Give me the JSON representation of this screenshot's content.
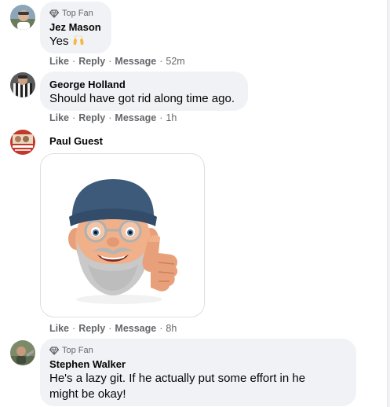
{
  "comments": [
    {
      "badge": "Top Fan",
      "author": "Jez Mason",
      "text": "Yes",
      "emoji": "raised-hands-emoji",
      "actions": {
        "like": "Like",
        "reply": "Reply",
        "message": "Message",
        "time": "52m"
      }
    },
    {
      "author": "George Holland",
      "text": "Should have got rid along time ago.",
      "actions": {
        "like": "Like",
        "reply": "Reply",
        "message": "Message",
        "time": "1h"
      }
    },
    {
      "author": "Paul Guest",
      "sticker": "memoji-thumbs-up",
      "actions": {
        "like": "Like",
        "reply": "Reply",
        "message": "Message",
        "time": "8h"
      }
    },
    {
      "badge": "Top Fan",
      "author": "Stephen Walker",
      "text_line1": "He's a lazy git. If he actually put some effort in he",
      "text_line2": "might be okay!"
    }
  ],
  "icons": {
    "badge": "diamond-icon"
  },
  "colors": {
    "bubble": "#f0f2f5",
    "secondary_text": "#65676b",
    "primary_text": "#050505"
  }
}
